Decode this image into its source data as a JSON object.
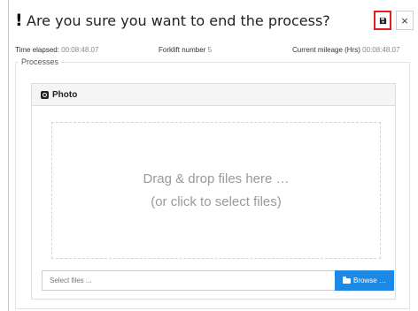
{
  "dialog": {
    "title_mark": "!",
    "title": "Are you sure you want to end the process?",
    "save_icon": "floppy-disk-icon",
    "close_label": "×"
  },
  "meta": {
    "time_elapsed_label": "Time elapsed:",
    "time_elapsed_value": "00:08:48.07",
    "forklift_label": "Forklift number",
    "forklift_value": "5",
    "mileage_label": "Current mileage (Hrs)",
    "mileage_value": "00:08:48.07"
  },
  "processes": {
    "legend": "Processes",
    "panel": {
      "icon": "camera-icon",
      "title": "Photo",
      "dropzone_line1": "Drag & drop files here …",
      "dropzone_line2": "(or click to select files)",
      "file_placeholder": "Select files ...",
      "browse_icon": "folder-open-icon",
      "browse_label": "Browse …"
    }
  },
  "colors": {
    "highlight_border": "#e02020",
    "browse_button": "#1e88e5"
  }
}
